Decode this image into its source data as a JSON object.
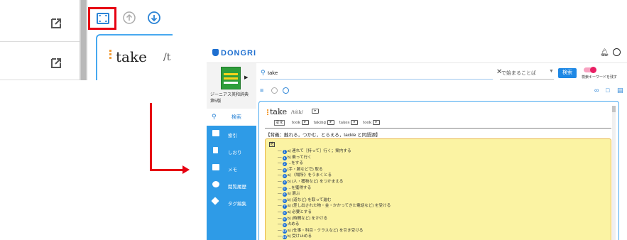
{
  "zoom": {
    "headword": "take",
    "pron_fragment": "/t"
  },
  "app": {
    "logo": "DONGRI",
    "book": {
      "name_line1": "ジーニアス英和辞典",
      "name_line2": "第5版"
    },
    "sidebar": {
      "search_label": "検索",
      "items": [
        {
          "label": "索引",
          "icon": "index-icon"
        },
        {
          "label": "しおり",
          "icon": "bookmark-icon"
        },
        {
          "label": "メモ",
          "icon": "memo-icon"
        },
        {
          "label": "閲覧履歴",
          "icon": "history-icon"
        },
        {
          "label": "タグ編集",
          "icon": "tag-icon"
        }
      ]
    },
    "search": {
      "value": "take",
      "mode": "で始まることば",
      "button": "検索",
      "toggle_label": "検索キーワードを残す"
    },
    "entry": {
      "headword": "take",
      "pron": "/téik/",
      "forms_tag": "変化",
      "forms": [
        "took",
        "taking",
        "takes",
        "took"
      ],
      "core": "【背義：触れる，つかむ，とらえる，tackle と同語源】",
      "marker": "他",
      "defs": [
        {
          "num": "1",
          "text": "a) 連れて［持って］行く；案内する"
        },
        {
          "num": "1",
          "text": "b) 乗って行く"
        },
        {
          "num": "2",
          "text": "…をする"
        },
        {
          "num": "3",
          "text": "(手・腕などで) 取る"
        },
        {
          "num": "4",
          "text": "a) 《場所》をうまくとる"
        },
        {
          "num": "4",
          "text": "b) (人・獲物など) をつかまえる"
        },
        {
          "num": "5",
          "text": "…を獲得する"
        },
        {
          "num": "6",
          "text": "a) 選ぶ"
        },
        {
          "num": "6",
          "text": "b) (道など) を取って進む"
        },
        {
          "num": "7",
          "text": "a) (差し出された物・金・かかってきた電話など) を受ける"
        },
        {
          "num": "8",
          "text": "a) 必要とする"
        },
        {
          "num": "8",
          "text": "b) (時間など) をかける"
        },
        {
          "num": "9",
          "text": "占める"
        },
        {
          "num": "10",
          "text": "a) (仕事・科目・クラスなど) を引き受ける"
        },
        {
          "num": "10",
          "text": "b) 受け止める"
        }
      ]
    }
  },
  "colors": {
    "highlight": "#e60012",
    "accent": "#2e9be7",
    "definition_bg": "#fbf3a3"
  }
}
